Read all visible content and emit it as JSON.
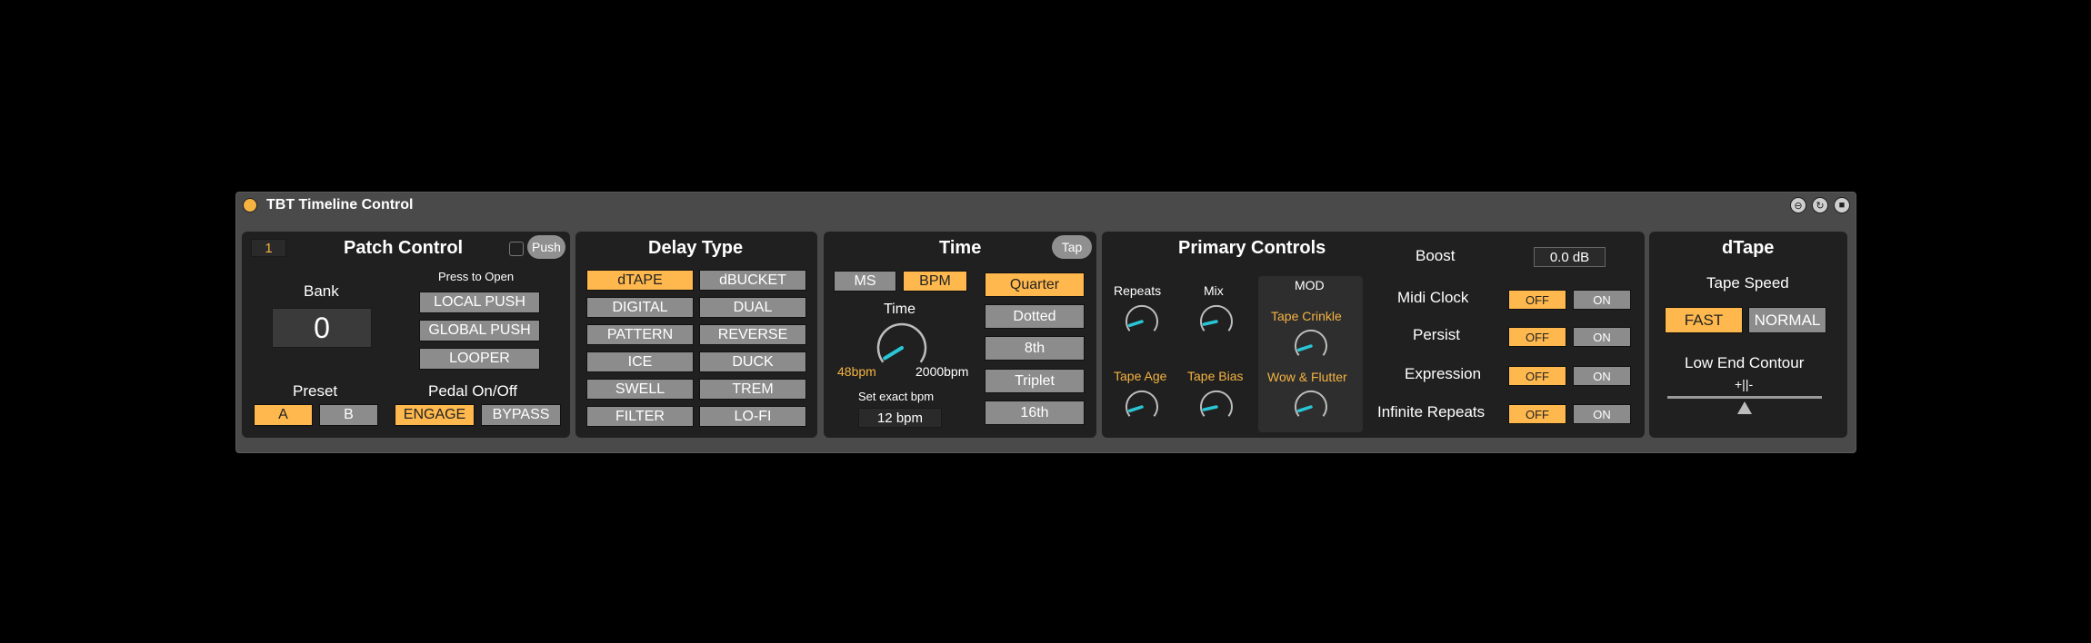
{
  "window": {
    "title": "TBT Timeline Control",
    "icons": [
      "link-icon",
      "sync-icon",
      "save-icon"
    ]
  },
  "patch": {
    "title": "Patch Control",
    "number": "1",
    "push_label": "Push",
    "bank_label": "Bank",
    "bank_value": "0",
    "press_to_open": "Press to Open",
    "open_buttons": [
      "LOCAL PUSH",
      "GLOBAL PUSH",
      "LOOPER"
    ],
    "preset_label": "Preset",
    "preset_a": "A",
    "preset_b": "B",
    "preset_selected": "A",
    "pedal_label": "Pedal On/Off",
    "engage": "ENGAGE",
    "bypass": "BYPASS",
    "pedal_selected": "ENGAGE"
  },
  "delay": {
    "title": "Delay Type",
    "types": [
      "dTAPE",
      "dBUCKET",
      "DIGITAL",
      "DUAL",
      "PATTERN",
      "REVERSE",
      "ICE",
      "DUCK",
      "SWELL",
      "TREM",
      "FILTER",
      "LO-FI"
    ],
    "selected": "dTAPE"
  },
  "time": {
    "title": "Time",
    "tap": "Tap",
    "ms": "MS",
    "bpm": "BPM",
    "unit_selected": "BPM",
    "knob_label": "Time",
    "min_label": "48bpm",
    "max_label": "2000bpm",
    "knob_value": 0.05,
    "exact_label": "Set exact bpm",
    "exact_value": "12 bpm",
    "divisions": [
      "Quarter",
      "Dotted",
      "8th",
      "Triplet",
      "16th"
    ],
    "division_selected": "Quarter"
  },
  "primary": {
    "title": "Primary Controls",
    "repeats": "Repeats",
    "mix": "Mix",
    "tape_age": "Tape Age",
    "tape_bias": "Tape Bias",
    "mod": "MOD",
    "tape_crinkle": "Tape Crinkle",
    "wow_flutter": "Wow & Flutter",
    "knob_values": {
      "repeats": 0.1,
      "mix": 0.12,
      "tape_age": 0.1,
      "tape_bias": 0.12,
      "tape_crinkle": 0.1,
      "wow_flutter": 0.1
    },
    "boost_label": "Boost",
    "boost_value": "0.0 dB",
    "toggles": [
      {
        "label": "Midi Clock",
        "state": "OFF"
      },
      {
        "label": "Persist",
        "state": "OFF"
      },
      {
        "label": "Expression",
        "state": "OFF"
      },
      {
        "label": "Infinite Repeats",
        "state": "OFF"
      }
    ],
    "off": "OFF",
    "on": "ON"
  },
  "dtape": {
    "title": "dTape",
    "speed_label": "Tape Speed",
    "fast": "FAST",
    "normal": "NORMAL",
    "speed_selected": "FAST",
    "contour_label": "Low End Contour",
    "contour_value": "+||-",
    "contour_position": 0.5
  },
  "colors": {
    "accent": "#ffb84d",
    "knob_indicator": "#29c6d6",
    "panel": "#202020",
    "device": "#4a4a4a"
  }
}
